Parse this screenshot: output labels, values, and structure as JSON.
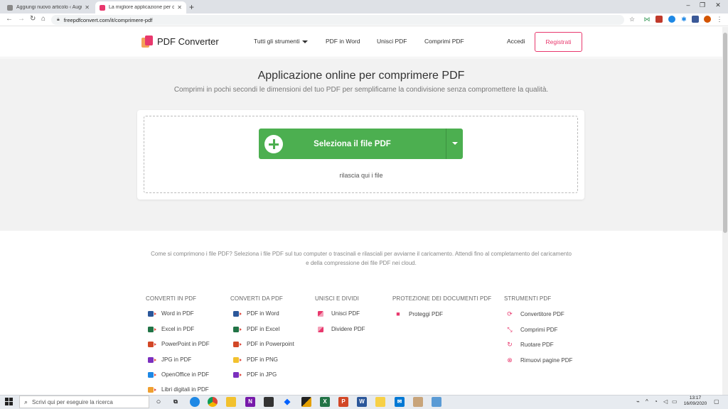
{
  "browser": {
    "tabs": [
      {
        "title": "Aggiungi nuovo articolo ‹ Augus",
        "active": false
      },
      {
        "title": "La migliore applicazione per com",
        "active": true
      }
    ],
    "url": "freepdfconvert.com/it/comprimere-pdf"
  },
  "header": {
    "brand": "PDF Converter",
    "nav": [
      "Tutti gli strumenti",
      "PDF in Word",
      "Unisci PDF",
      "Comprimi PDF"
    ],
    "login": "Accedi",
    "register": "Registrati"
  },
  "hero": {
    "title": "Applicazione online per comprimere PDF",
    "subtitle": "Comprimi in pochi secondi le dimensioni del tuo PDF per semplificarne la condivisione senza compromettere la qualità.",
    "select_button": "Seleziona il file PDF",
    "drop_hint": "rilascia qui i file"
  },
  "info": "Come si comprimono i file PDF? Seleziona i file PDF sul tuo computer o trascinali e rilasciali per avviarne il caricamento. Attendi fino al completamento del caricamento e della compressione dei file PDF nei cloud.",
  "footer": {
    "columns": [
      {
        "heading": "CONVERTI IN PDF",
        "items": [
          "Word in PDF",
          "Excel in PDF",
          "PowerPoint in PDF",
          "JPG in PDF",
          "OpenOffice in PDF",
          "Libri digitali in PDF"
        ]
      },
      {
        "heading": "CONVERTI DA PDF",
        "items": [
          "PDF in Word",
          "PDF in Excel",
          "PDF in Powerpoint",
          "PDF in PNG",
          "PDF in JPG"
        ]
      },
      {
        "heading": "UNISCI E DIVIDI",
        "items": [
          "Unisci PDF",
          "Dividere PDF"
        ]
      },
      {
        "heading": "PROTEZIONE DEI DOCUMENTI PDF",
        "items": [
          "Proteggi PDF"
        ]
      },
      {
        "heading": "STRUMENTI PDF",
        "items": [
          "Convertitore PDF",
          "Comprimi PDF",
          "Ruotare PDF",
          "Rimuovi pagine PDF"
        ]
      }
    ]
  },
  "taskbar": {
    "search_placeholder": "Scrivi qui per eseguire la ricerca",
    "time": "13:17",
    "date": "16/09/2020"
  },
  "colors": {
    "accent_green": "#4caf50",
    "accent_pink": "#e8386d"
  }
}
